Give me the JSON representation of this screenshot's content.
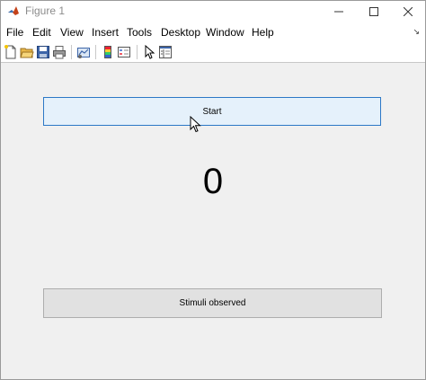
{
  "window": {
    "title": "Figure 1"
  },
  "menubar": {
    "items": [
      "File",
      "Edit",
      "View",
      "Insert",
      "Tools",
      "Desktop",
      "Window",
      "Help"
    ]
  },
  "toolbar": {
    "icons": [
      "new-figure-icon",
      "open-file-icon",
      "save-icon",
      "print-icon",
      "link-plot-icon",
      "colorbar-icon",
      "legend-icon",
      "edit-plot-icon",
      "property-inspector-icon"
    ]
  },
  "main": {
    "start_label": "Start",
    "counter_value": "0",
    "stimuli_label": "Stimuli observed"
  },
  "colors": {
    "start_bg": "#e5f1fb",
    "start_border": "#2c78c6",
    "stimuli_bg": "#e1e1e1",
    "canvas_bg": "#f0f0f0"
  }
}
